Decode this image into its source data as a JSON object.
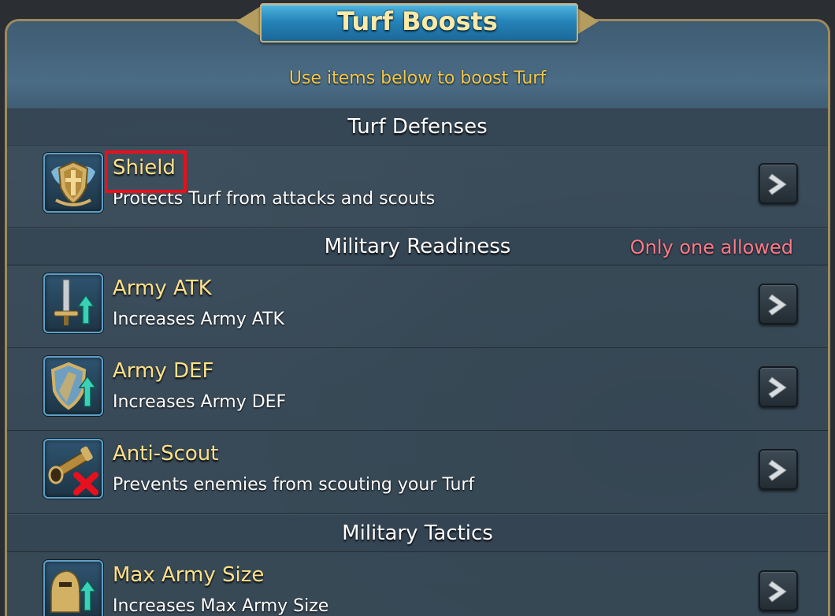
{
  "window": {
    "title": "Turf Boosts",
    "subtitle": "Use items below to boost Turf"
  },
  "sections": [
    {
      "title": "Turf Defenses",
      "note": "",
      "items": [
        {
          "name": "Shield",
          "description": "Protects Turf from attacks and scouts",
          "icon": "shield-icon"
        }
      ]
    },
    {
      "title": "Military Readiness",
      "note": "Only one allowed",
      "items": [
        {
          "name": "Army ATK",
          "description": "Increases Army ATK",
          "icon": "sword-up-icon"
        },
        {
          "name": "Army DEF",
          "description": "Increases Army DEF",
          "icon": "shield-up-icon"
        },
        {
          "name": "Anti-Scout",
          "description": "Prevents enemies from scouting your Turf",
          "icon": "spyglass-cross-icon"
        }
      ]
    },
    {
      "title": "Military Tactics",
      "note": "",
      "items": [
        {
          "name": "Max Army Size",
          "description": "Increases Max Army Size",
          "icon": "helmet-up-icon"
        }
      ]
    }
  ],
  "colors": {
    "accent_gold": "#fde08a",
    "subtitle_yellow": "#f2c84b",
    "note_pink": "#ff7a8a",
    "highlight_red": "#e8101c",
    "title_plate_blue": "#2584b9"
  }
}
